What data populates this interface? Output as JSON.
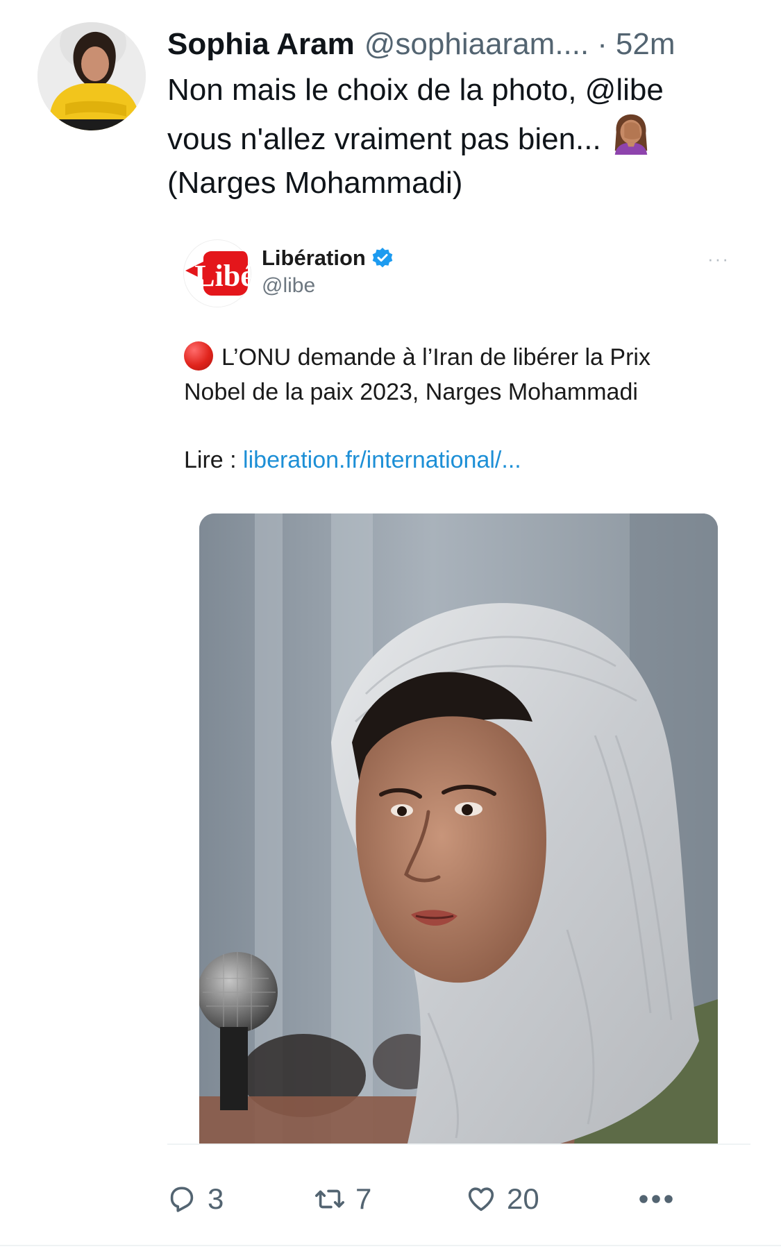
{
  "tweet": {
    "display_name": "Sophia Aram",
    "handle": "@sophiaaram....",
    "separator": "·",
    "time": "52m",
    "text_lines": [
      "Non mais le choix de la photo, @libe",
      "vous n'allez vraiment pas bien...",
      "(Narges Mohammadi)"
    ],
    "emoji": "facepalm-emoji"
  },
  "embed": {
    "account_name": "Libération",
    "handle": "@libe",
    "logo_text": "Libé",
    "more_label": "···",
    "text_lines": [
      "L’ONU demande à l’Iran de libérer la Prix",
      "Nobel de la paix 2023, Narges Mohammadi"
    ],
    "lead_icon": "red-circle-emoji",
    "read_label": "Lire : ",
    "link_text": "liberation.fr/international/...",
    "photo": "photo-of-narges-mohammadi"
  },
  "actions": {
    "reply_count": "3",
    "retweet_count": "7",
    "like_count": "20",
    "icons": [
      "reply-icon",
      "retweet-icon",
      "like-icon",
      "more-icon"
    ]
  },
  "colors": {
    "text": "#0f1419",
    "secondary": "#536471",
    "link": "#1d8fd6",
    "verified": "#1d9bf0",
    "libe_red": "#e4161b"
  }
}
